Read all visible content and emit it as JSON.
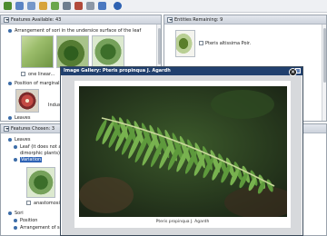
{
  "features_available": {
    "title": "Features Available: 43"
  },
  "entities_remaining": {
    "title": "Entities Remaining: 9",
    "items": [
      {
        "label": "Pteris altissima Poir."
      }
    ]
  },
  "features_chosen": {
    "title": "Features Chosen: 3"
  },
  "available_items": [
    {
      "label": "Arrangement of sori in the undersice surface of the leaf"
    },
    {
      "label": "one linear..."
    },
    {
      "label": "Position of marginal sori"
    },
    {
      "label": "Indusia..."
    },
    {
      "label": "Leaves"
    }
  ],
  "chosen_items": [
    {
      "label": "Leaves"
    },
    {
      "label": "Leaf (it does not apply for"
    },
    {
      "label": "dimorphic plants)"
    },
    {
      "label": "Variation"
    },
    {
      "label": "anastomosi..."
    },
    {
      "label": "Sori"
    },
    {
      "label": "Position"
    },
    {
      "label": "Arrangement of sori in the"
    }
  ],
  "gallery": {
    "title": "Image Gallery: Pteris propinqua J. Agardh",
    "caption": "Pteris propinqua J. Agardh",
    "close_glyph": "×"
  },
  "toolbar_icons": [
    "restart-icon",
    "open-icon",
    "save-icon",
    "tag-icon",
    "filter-icon",
    "sort-icon",
    "tools-icon",
    "keys-icon",
    "search-icon",
    "help-icon"
  ],
  "colors": {
    "title_bar": "#21406e",
    "panel_header": "#dfe4eb",
    "highlight": "#2f63b5"
  }
}
